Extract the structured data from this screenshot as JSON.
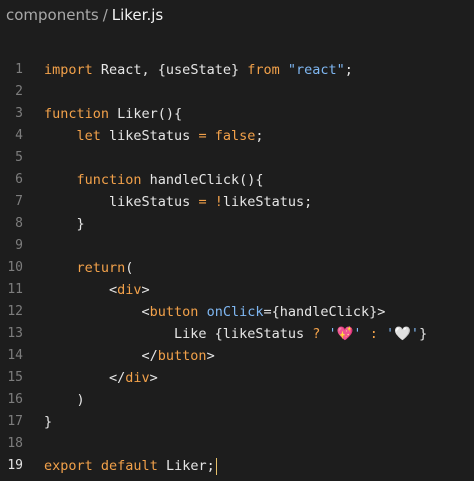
{
  "breadcrumb": {
    "folder": "components",
    "separator": "/",
    "file": "Liker.js"
  },
  "colors": {
    "background": "#1d1d1d",
    "keyword": "#f2a14a",
    "string": "#7fb7f2",
    "line_number": "#7d7d7d"
  },
  "lines": [
    {
      "n": "1",
      "tokens": [
        {
          "t": "import",
          "c": "kw"
        },
        {
          "t": " React, {useState} ",
          "c": "plain"
        },
        {
          "t": "from",
          "c": "kw"
        },
        {
          "t": " ",
          "c": "plain"
        },
        {
          "t": "\"react\"",
          "c": "str"
        },
        {
          "t": ";",
          "c": "plain"
        }
      ]
    },
    {
      "n": "2",
      "tokens": []
    },
    {
      "n": "3",
      "tokens": [
        {
          "t": "function",
          "c": "kw"
        },
        {
          "t": " Liker(){",
          "c": "plain"
        }
      ]
    },
    {
      "n": "4",
      "tokens": [
        {
          "t": "    ",
          "c": "plain"
        },
        {
          "t": "let",
          "c": "kw"
        },
        {
          "t": " likeStatus ",
          "c": "plain"
        },
        {
          "t": "=",
          "c": "op"
        },
        {
          "t": " ",
          "c": "plain"
        },
        {
          "t": "false",
          "c": "kw"
        },
        {
          "t": ";",
          "c": "plain"
        }
      ]
    },
    {
      "n": "5",
      "tokens": []
    },
    {
      "n": "6",
      "tokens": [
        {
          "t": "    ",
          "c": "plain"
        },
        {
          "t": "function",
          "c": "kw"
        },
        {
          "t": " handleClick(){",
          "c": "plain"
        }
      ]
    },
    {
      "n": "7",
      "tokens": [
        {
          "t": "        likeStatus ",
          "c": "plain"
        },
        {
          "t": "=",
          "c": "op"
        },
        {
          "t": " ",
          "c": "plain"
        },
        {
          "t": "!",
          "c": "op"
        },
        {
          "t": "likeStatus;",
          "c": "plain"
        }
      ]
    },
    {
      "n": "8",
      "tokens": [
        {
          "t": "    }",
          "c": "plain"
        }
      ]
    },
    {
      "n": "9",
      "tokens": []
    },
    {
      "n": "10",
      "tokens": [
        {
          "t": "    ",
          "c": "plain"
        },
        {
          "t": "return",
          "c": "kw"
        },
        {
          "t": "(",
          "c": "plain"
        }
      ]
    },
    {
      "n": "11",
      "tokens": [
        {
          "t": "        <",
          "c": "plain"
        },
        {
          "t": "div",
          "c": "kw"
        },
        {
          "t": ">",
          "c": "plain"
        }
      ]
    },
    {
      "n": "12",
      "tokens": [
        {
          "t": "            <",
          "c": "plain"
        },
        {
          "t": "button",
          "c": "kw"
        },
        {
          "t": " ",
          "c": "plain"
        },
        {
          "t": "onClick",
          "c": "str"
        },
        {
          "t": "={handleClick}>",
          "c": "plain"
        }
      ]
    },
    {
      "n": "13",
      "tokens": [
        {
          "t": "                Like {likeStatus ",
          "c": "plain"
        },
        {
          "t": "?",
          "c": "op"
        },
        {
          "t": " ",
          "c": "plain"
        },
        {
          "t": "'💖'",
          "c": "str"
        },
        {
          "t": " ",
          "c": "plain"
        },
        {
          "t": ":",
          "c": "op"
        },
        {
          "t": " ",
          "c": "plain"
        },
        {
          "t": "'🤍'",
          "c": "str"
        },
        {
          "t": "}",
          "c": "plain"
        }
      ]
    },
    {
      "n": "14",
      "tokens": [
        {
          "t": "            </",
          "c": "plain"
        },
        {
          "t": "button",
          "c": "kw"
        },
        {
          "t": ">",
          "c": "plain"
        }
      ]
    },
    {
      "n": "15",
      "tokens": [
        {
          "t": "        </",
          "c": "plain"
        },
        {
          "t": "div",
          "c": "kw"
        },
        {
          "t": ">",
          "c": "plain"
        }
      ]
    },
    {
      "n": "16",
      "tokens": [
        {
          "t": "    )",
          "c": "plain"
        }
      ]
    },
    {
      "n": "17",
      "tokens": [
        {
          "t": "}",
          "c": "plain"
        }
      ]
    },
    {
      "n": "18",
      "tokens": []
    },
    {
      "n": "19",
      "tokens": [
        {
          "t": "export",
          "c": "kw"
        },
        {
          "t": " ",
          "c": "plain"
        },
        {
          "t": "default",
          "c": "kw"
        },
        {
          "t": " Liker;",
          "c": "plain"
        }
      ],
      "active": true
    }
  ]
}
